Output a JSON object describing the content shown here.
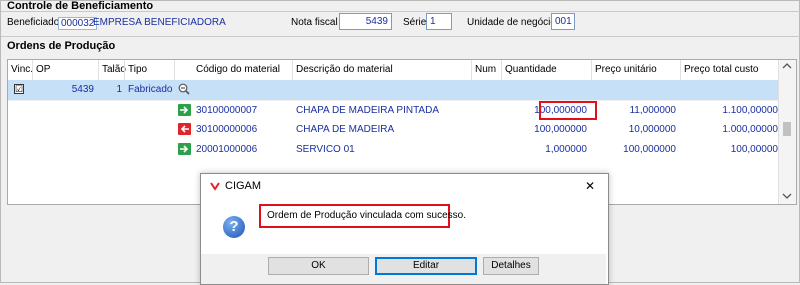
{
  "header": {
    "section_title": "Controle de Beneficiamento",
    "beneficiador_label": "Beneficiador",
    "beneficiador_code": "000032",
    "beneficiador_name": "EMPRESA BENEFICIADORA",
    "nota_fiscal_label": "Nota fiscal",
    "nota_fiscal_value": "5439",
    "serie_label": "Série",
    "serie_value": "1",
    "unidade_label": "Unidade de negócio",
    "unidade_value": "001"
  },
  "ordens": {
    "section_title": "Ordens de Produção",
    "columns": [
      "Vinc.",
      "OP",
      "Talão",
      "Tipo",
      "Código do material",
      "Descrição do material",
      "Num",
      "Quantidade",
      "Preço unitário",
      "Preço total custo"
    ],
    "parent_row": {
      "checked": "☑",
      "op": "5439",
      "talao": "1",
      "tipo": "Fabricado",
      "icon": "zoom-out-icon"
    },
    "rows": [
      {
        "icon": "arrow-right-green-icon",
        "codigo": "30100000007",
        "descricao": "CHAPA DE MADEIRA PINTADA",
        "quantidade": "100,000000",
        "preco_unitario": "11,000000",
        "preco_total": "1.100,00000",
        "highlighted": true
      },
      {
        "icon": "arrow-left-red-icon",
        "codigo": "30100000006",
        "descricao": "CHAPA DE MADEIRA",
        "quantidade": "100,000000",
        "preco_unitario": "10,000000",
        "preco_total": "1.000,00000",
        "highlighted": false
      },
      {
        "icon": "arrow-right-green-icon",
        "codigo": "20001000006",
        "descricao": "SERVICO 01",
        "quantidade": "1,000000",
        "preco_unitario": "100,000000",
        "preco_total": "100,00000",
        "highlighted": false
      }
    ]
  },
  "dialog": {
    "title": "CIGAM",
    "message": "Ordem de Produção vinculada com sucesso.",
    "ok_label": "OK",
    "editar_label": "Editar",
    "detalhes_label": "Detalhes",
    "close_glyph": "✕",
    "icon": "question-icon"
  },
  "colors": {
    "link_blue": "#1a2fa0",
    "selection": "#c6e0f7",
    "highlight_red": "#e0101a",
    "green_icon": "#2ca14a",
    "red_icon": "#e0242b"
  }
}
